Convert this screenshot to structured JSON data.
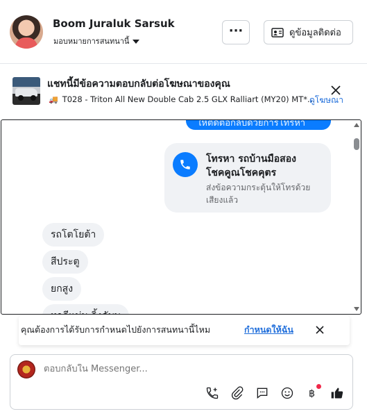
{
  "header": {
    "user_name": "Boom Juraluk Sarsuk",
    "assign_label": "มอบหมายการสนทนานี้",
    "more_label": "···",
    "contact_label": "ดูข้อมูลติดต่อ"
  },
  "ad": {
    "title": "แชทนี้มีข้อความตอบกลับต่อโฆษณาของคุณ",
    "product": "T028 - Triton All New Double Cab 2.5 GLX Ralliart (MY20) MT*...",
    "view_ad_label": "ดูโฆษณา"
  },
  "thread": {
    "outgoing_partial": "ให้ติดต่อกลับด้วยการโทรหา",
    "call_title": "โทรหา รถบ้านมือสอง โชคคูณโชคคูตร",
    "call_title_lines": [
      "โทรหา รถบ้านมือสอง",
      "โชคคูณโชคคุตร"
    ],
    "call_subtitle_lines": [
      "ส่งข้อความกระตุ้นให้โทรด้วย",
      "เสียงแล้ว"
    ],
    "messages": [
      "รถโตโยต้า",
      "สีประตู",
      "ยกสูง",
      "หาดีแม่ม ลิ้งคับบ"
    ]
  },
  "reminder": {
    "text": "คุณต้องการได้รับการกำหนดไปยังการสนทนานี้ไหม",
    "link": "กำหนดให้ฉัน"
  },
  "composer": {
    "placeholder": "ตอบกลับใน Messenger..."
  },
  "colors": {
    "accent": "#0a7cff",
    "link": "#216fdb",
    "notification": "#f02849"
  }
}
